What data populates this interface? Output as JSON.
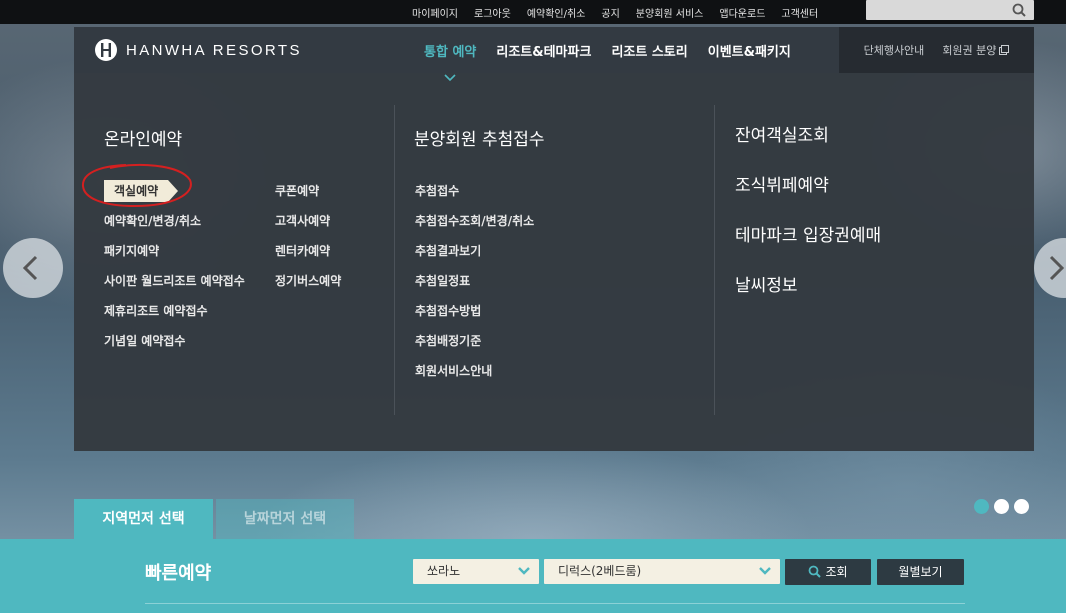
{
  "utility_nav": {
    "links": [
      "마이페이지",
      "로그아웃",
      "예약확인/취소",
      "공지",
      "분양회원 서비스",
      "앱다운로드",
      "고객센터"
    ],
    "search_placeholder": ""
  },
  "header": {
    "logo_text": "HANWHA RESORTS",
    "menu": [
      {
        "label": "통합 예약",
        "active": true
      },
      {
        "label": "리조트&테마파크",
        "active": false
      },
      {
        "label": "리조트 스토리",
        "active": false
      },
      {
        "label": "이벤트&패키지",
        "active": false
      }
    ],
    "right_links": [
      "단체행사안내",
      "회원권 분양"
    ]
  },
  "mega_menu": {
    "online": {
      "title": "온라인예약",
      "left_items": [
        "객실예약",
        "예약확인/변경/취소",
        "패키지예약",
        "사이판 월드리조트 예약접수",
        "제휴리조트 예약접수",
        "기념일 예약접수"
      ],
      "right_items": [
        "쿠폰예약",
        "고객사예약",
        "렌터카예약",
        "정기버스예약"
      ],
      "selected": "객실예약"
    },
    "lottery": {
      "title": "분양회원 추첨접수",
      "items": [
        "추첨접수",
        "추첨접수조회/변경/취소",
        "추첨결과보기",
        "추첨일정표",
        "추첨접수방법",
        "추첨배정기준",
        "회원서비스안내"
      ]
    },
    "others": {
      "items": [
        "잔여객실조회",
        "조식뷔페예약",
        "테마파크 입장권예매",
        "날씨정보"
      ]
    }
  },
  "carousel": {
    "dots": 3,
    "active_dot": 0
  },
  "quick_reservation": {
    "tabs": [
      "지역먼저 선택",
      "날짜먼저 선택"
    ],
    "active_tab": 0,
    "title": "빠른예약",
    "resort_select": "쏘라노",
    "room_select": "디럭스(2베드룸)",
    "search_button": "조회",
    "monthly_button": "월별보기"
  },
  "colors": {
    "accent": "#4fb8c0",
    "menu_bg": "#343a40",
    "annotation": "#d42020"
  }
}
